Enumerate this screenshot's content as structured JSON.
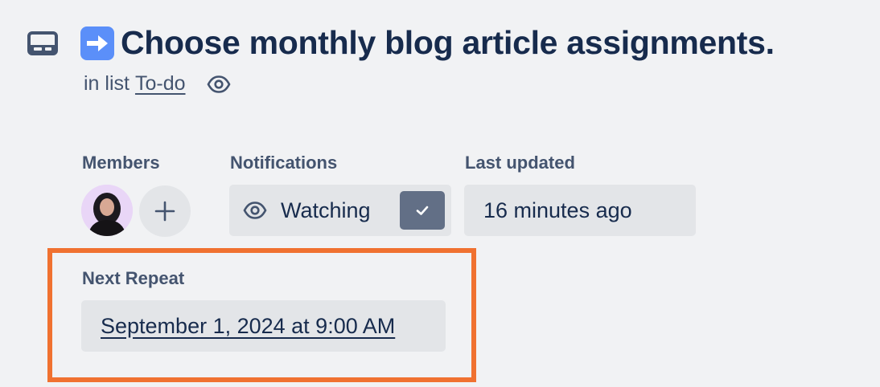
{
  "card": {
    "title": "Choose monthly blog article assignments.",
    "title_emoji": "arrow-right-emoji",
    "list_prefix": "in list",
    "list_name": "To-do"
  },
  "members": {
    "label": "Members",
    "avatar_icon": "user-avatar"
  },
  "notifications": {
    "label": "Notifications",
    "button_label": "Watching",
    "checked": true
  },
  "last_updated": {
    "label": "Last updated",
    "value": "16 minutes ago"
  },
  "next_repeat": {
    "label": "Next Repeat",
    "value": "September 1, 2024 at 9:00 AM"
  },
  "colors": {
    "background": "#f1f2f4",
    "text": "#172b4d",
    "muted_text": "#44546f",
    "button_bg": "#e3e5e8",
    "check_bg": "#626f86",
    "highlight": "#f07130",
    "emoji_bg": "#5b8ff9"
  }
}
